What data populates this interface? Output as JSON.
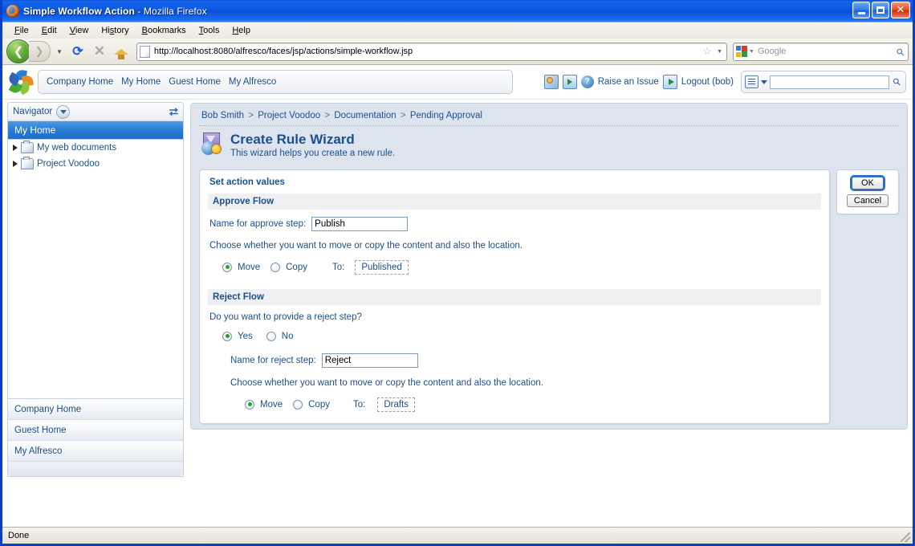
{
  "window": {
    "title_main": "Simple Workflow Action",
    "title_sep": " - Mozilla Firefox",
    "minimize_label": "Minimize",
    "maximize_label": "Maximize",
    "close_label": "Close"
  },
  "menubar": [
    {
      "label": "File",
      "accel": "F"
    },
    {
      "label": "Edit",
      "accel": "E"
    },
    {
      "label": "View",
      "accel": "V"
    },
    {
      "label": "History",
      "accel": "s"
    },
    {
      "label": "Bookmarks",
      "accel": "B"
    },
    {
      "label": "Tools",
      "accel": "T"
    },
    {
      "label": "Help",
      "accel": "H"
    }
  ],
  "toolbar": {
    "back_icon": "back-arrow-icon",
    "forward_icon": "forward-arrow-icon",
    "dropdown_icon": "chevron-down-icon",
    "reload_icon": "reload-icon",
    "stop_icon": "stop-icon",
    "home_icon": "home-icon",
    "url": "http://localhost:8080/alfresco/faces/jsp/actions/simple-workflow.jsp",
    "bookmark_star_icon": "star-icon",
    "search_placeholder": "Google",
    "search_value": "",
    "search_provider": "Google"
  },
  "alfresco_header": {
    "logo": "alfresco-logo",
    "nav_links": [
      "Company Home",
      "My Home",
      "Guest Home",
      "My Alfresco"
    ],
    "tool_icons": [
      "manage-users-icon",
      "invite-users-icon",
      "help-icon"
    ],
    "raise_issue_label": "Raise an Issue",
    "logout_label": "Logout (bob)",
    "search_value": "",
    "search_dropdown_icon": "search-options-icon",
    "search_go_icon": "search-icon"
  },
  "sidebar": {
    "panel_title": "Navigator",
    "collapse_icon": "chevron-down-icon",
    "refresh_icon": "refresh-icon",
    "selected_item": "My Home",
    "tree": [
      {
        "label": "My web documents",
        "icon": "folder-icon",
        "expander": "triangle-right-icon"
      },
      {
        "label": "Project Voodoo",
        "icon": "folder-icon",
        "expander": "triangle-right-icon"
      }
    ],
    "shortcuts": [
      "Company Home",
      "Guest Home",
      "My Alfresco"
    ]
  },
  "content": {
    "breadcrumb": [
      "Bob Smith",
      "Project Voodoo",
      "Documentation",
      "Pending Approval"
    ],
    "breadcrumb_separator": ">",
    "wizard_icon": "create-rule-wizard-icon",
    "wizard_title": "Create Rule Wizard",
    "wizard_subtitle": "This wizard helps you create a new rule.",
    "panel_title": "Set action values",
    "approve": {
      "section_title": "Approve Flow",
      "name_label": "Name for approve step:",
      "name_value": "Publish",
      "instruction": "Choose whether you want to move or copy the content and also the location.",
      "options": [
        {
          "label": "Move",
          "selected": true
        },
        {
          "label": "Copy",
          "selected": false
        }
      ],
      "to_label": "To:",
      "destination": "Published"
    },
    "reject": {
      "section_title": "Reject Flow",
      "question": "Do you want to provide a reject step?",
      "yes_no": [
        {
          "label": "Yes",
          "selected": true
        },
        {
          "label": "No",
          "selected": false
        }
      ],
      "name_label": "Name for reject step:",
      "name_value": "Reject",
      "instruction": "Choose whether you want to move or copy the content and also the location.",
      "options": [
        {
          "label": "Move",
          "selected": true
        },
        {
          "label": "Copy",
          "selected": false
        }
      ],
      "to_label": "To:",
      "destination": "Drafts"
    },
    "actions": {
      "ok_label": "OK",
      "cancel_label": "Cancel"
    }
  },
  "statusbar": {
    "text": "Done",
    "grip_icon": "resize-grip-icon"
  },
  "colors": {
    "title_blue": "#0b53d9",
    "link_blue": "#1d4f8c",
    "selected_blue": "#2a7cd4",
    "radio_green": "#2aa02a",
    "band_gray": "#eef0f2",
    "content_bg": "#dde4ee"
  }
}
